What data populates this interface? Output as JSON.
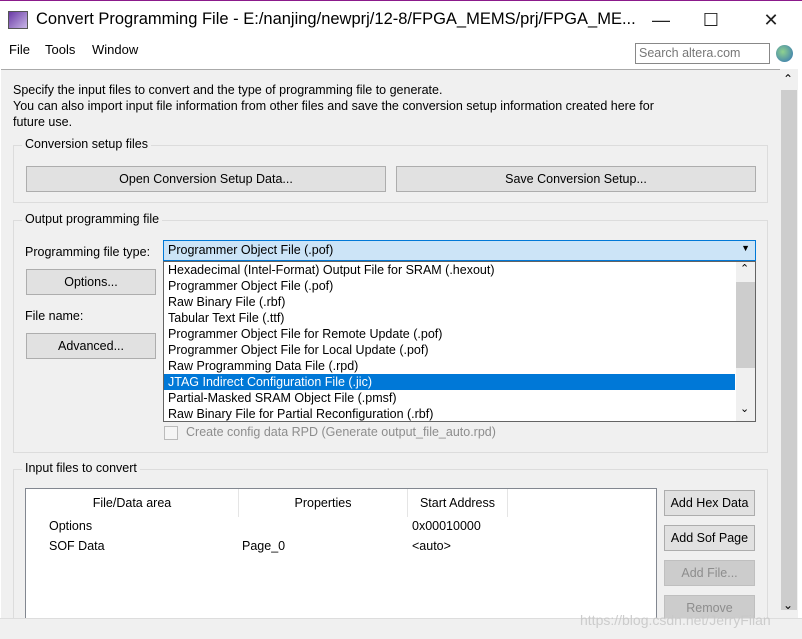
{
  "window": {
    "title": "Convert Programming File - E:/nanjing/newprj/12-8/FPGA_MEMS/prj/FPGA_ME...",
    "minimize": "—",
    "maximize": "☐",
    "close": "✕"
  },
  "menu": [
    "File",
    "Tools",
    "Window"
  ],
  "search": {
    "placeholder": "Search altera.com"
  },
  "intro": [
    "Specify the input files to convert and the type of programming file to generate.",
    "You can also import input file information from other files and save the conversion setup information created here for",
    "future use."
  ],
  "setup": {
    "label": "Conversion setup files",
    "open": "Open Conversion Setup Data...",
    "save": "Save Conversion Setup..."
  },
  "output": {
    "label": "Output programming file",
    "type_label": "Programming file type:",
    "type_value": "Programmer Object File (.pof)",
    "options": "Options...",
    "file_name_label": "File name:",
    "advanced": "Advanced...",
    "rpd_checkbox": "Create config data RPD (Generate output_file_auto.rpd)",
    "dropdown": [
      "Hexadecimal (Intel-Format) Output File for SRAM (.hexout)",
      "Programmer Object File (.pof)",
      "Raw Binary File (.rbf)",
      "Tabular Text File (.ttf)",
      "Programmer Object File for Remote Update (.pof)",
      "Programmer Object File for Local Update (.pof)",
      "Raw Programming Data File (.rpd)",
      "JTAG Indirect Configuration File (.jic)",
      "Partial-Masked SRAM Object File (.pmsf)",
      "Raw Binary File for Partial Reconfiguration (.rbf)"
    ],
    "selected_index": 7
  },
  "input": {
    "label": "Input files to convert",
    "columns": [
      "File/Data area",
      "Properties",
      "Start Address"
    ],
    "rows": [
      [
        "Options",
        "",
        "0x00010000"
      ],
      [
        "SOF Data",
        "Page_0",
        "<auto>"
      ]
    ],
    "buttons": {
      "add_hex": "Add Hex Data",
      "add_sof": "Add Sof Page",
      "add_file": "Add File...",
      "remove": "Remove"
    }
  },
  "watermark": "https://blog.csdn.net/JerryFilan"
}
